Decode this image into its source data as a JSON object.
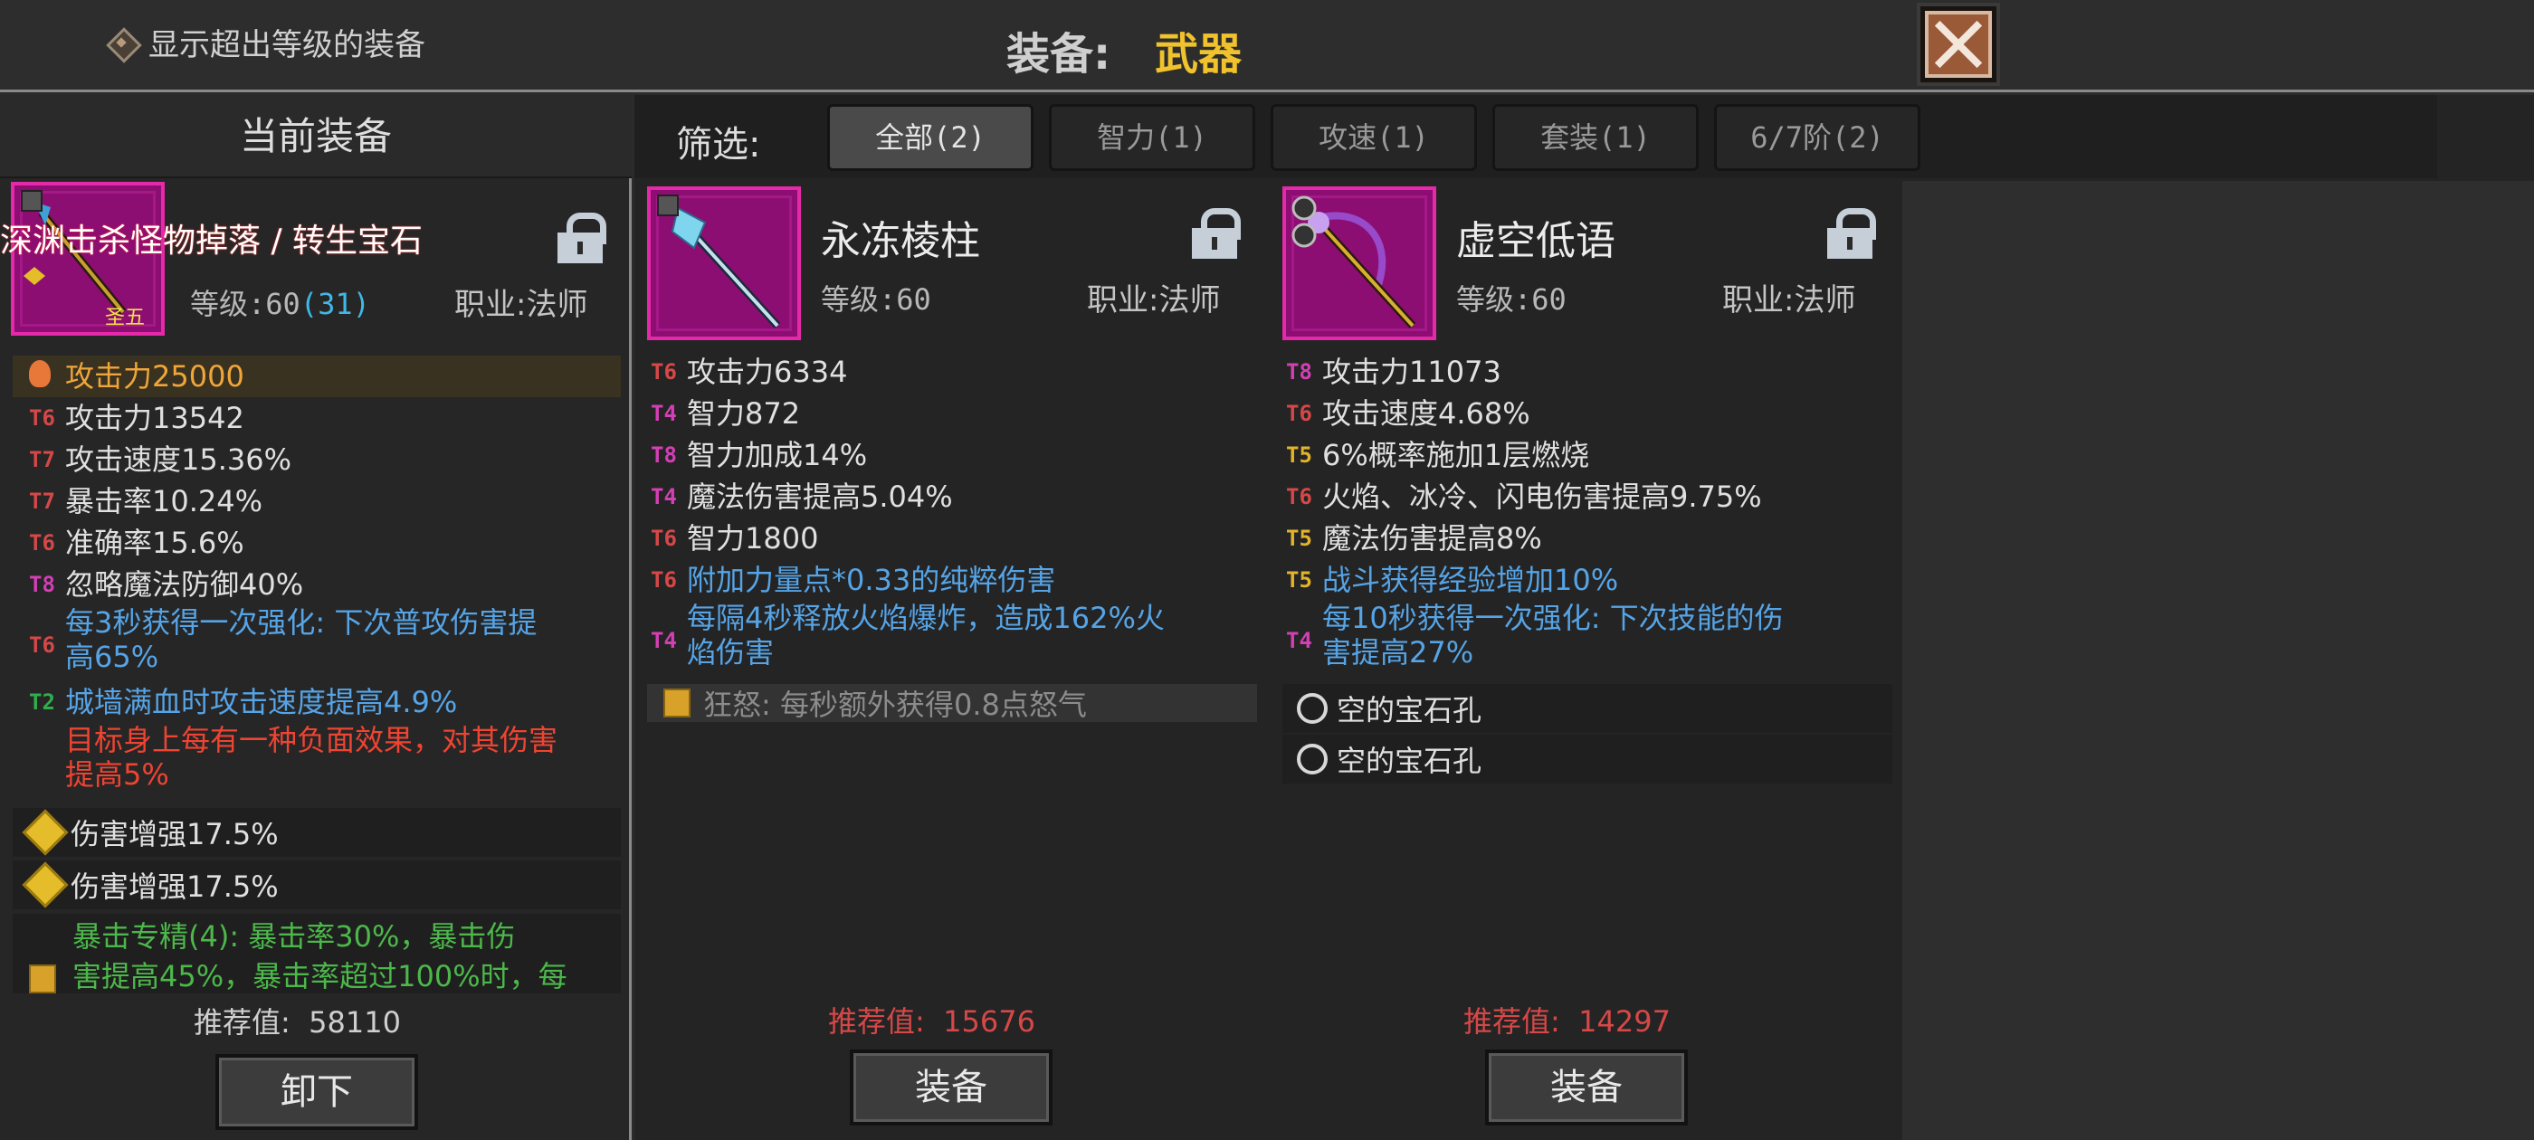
{
  "top": {
    "show_over_label": "显示超出等级的装备",
    "title_label": "装备:",
    "title_value": "武器"
  },
  "left": {
    "header": "当前装备",
    "item": {
      "overlay_text": "深渊击杀怪物掉落 / 转生宝石",
      "badge": "圣五",
      "level_label": "等级:",
      "level": "60",
      "level_bonus": "(31)",
      "class": "职业:法师"
    },
    "stats": [
      {
        "tier": "",
        "text": "攻击力25000",
        "color": "orange"
      },
      {
        "tier": "T6",
        "text": "攻击力13542",
        "color": "white"
      },
      {
        "tier": "T7",
        "text": "攻击速度15.36%",
        "color": "white"
      },
      {
        "tier": "T7",
        "text": "暴击率10.24%",
        "color": "white"
      },
      {
        "tier": "T6",
        "text": "准确率15.6%",
        "color": "white"
      },
      {
        "tier": "T8",
        "text": "忽略魔法防御40%",
        "color": "white"
      },
      {
        "tier": "T6",
        "text": "每3秒获得一次强化: 下次普攻伤害提",
        "text2": "高65%",
        "color": "blue"
      },
      {
        "tier": "T2",
        "text": "城墙满血时攻击速度提高4.9%",
        "color": "blue"
      },
      {
        "tier": "",
        "text": "目标身上每有一种负面效果，对其伤害",
        "text2": "提高5%",
        "color": "red"
      }
    ],
    "gems": [
      "伤害增强17.5%",
      "伤害增强17.5%"
    ],
    "set_bonus": "暴击专精(4): 暴击率30%，暴击伤",
    "set_bonus2": "害提高45%，暴击率超过100%时，每",
    "recommend_label": "推荐值:",
    "recommend_value": "58110",
    "button": "卸下"
  },
  "filter": {
    "label": "筛选:",
    "tabs": [
      "全部(2)",
      "智力(1)",
      "攻速(1)",
      "套装(1)",
      "6/7阶(2)"
    ]
  },
  "cards": [
    {
      "name": "永冻棱柱",
      "level": "等级:60",
      "class": "职业:法师",
      "stats": [
        {
          "tier": "T6",
          "text": "攻击力6334",
          "color": "white"
        },
        {
          "tier": "T4",
          "text": "智力872",
          "color": "white"
        },
        {
          "tier": "T8",
          "text": "智力加成14%",
          "color": "white"
        },
        {
          "tier": "T4",
          "text": "魔法伤害提高5.04%",
          "color": "white"
        },
        {
          "tier": "T6",
          "text": "智力1800",
          "color": "white"
        },
        {
          "tier": "T6",
          "text": "附加力量点*0.33的纯粹伤害",
          "color": "blue"
        },
        {
          "tier": "T4",
          "text": "每隔4秒释放火焰爆炸，造成162%火",
          "text2": "焰伤害",
          "color": "blue"
        }
      ],
      "rage": "狂怒: 每秒额外获得0.8点怒气",
      "recommend_label": "推荐值:",
      "recommend_value": "15676",
      "button": "装备"
    },
    {
      "name": "虚空低语",
      "level": "等级:60",
      "class": "职业:法师",
      "stats": [
        {
          "tier": "T8",
          "text": "攻击力11073",
          "color": "white"
        },
        {
          "tier": "T6",
          "text": "攻击速度4.68%",
          "color": "white"
        },
        {
          "tier": "T5",
          "text": "6%概率施加1层燃烧",
          "color": "white"
        },
        {
          "tier": "T6",
          "text": "火焰、冰冷、闪电伤害提高9.75%",
          "color": "white"
        },
        {
          "tier": "T5",
          "text": "魔法伤害提高8%",
          "color": "white"
        },
        {
          "tier": "T5",
          "text": "战斗获得经验增加10%",
          "color": "blue"
        },
        {
          "tier": "T4",
          "text": "每10秒获得一次强化: 下次技能的伤",
          "text2": "害提高27%",
          "color": "blue"
        }
      ],
      "gems": [
        "空的宝石孔",
        "空的宝石孔"
      ],
      "recommend_label": "推荐值:",
      "recommend_value": "14297",
      "button": "装备"
    }
  ],
  "colors": {
    "accent_gold": "#f0c22c",
    "rarity_magenta": "#e42aa8",
    "recommend_red": "#d64848"
  }
}
